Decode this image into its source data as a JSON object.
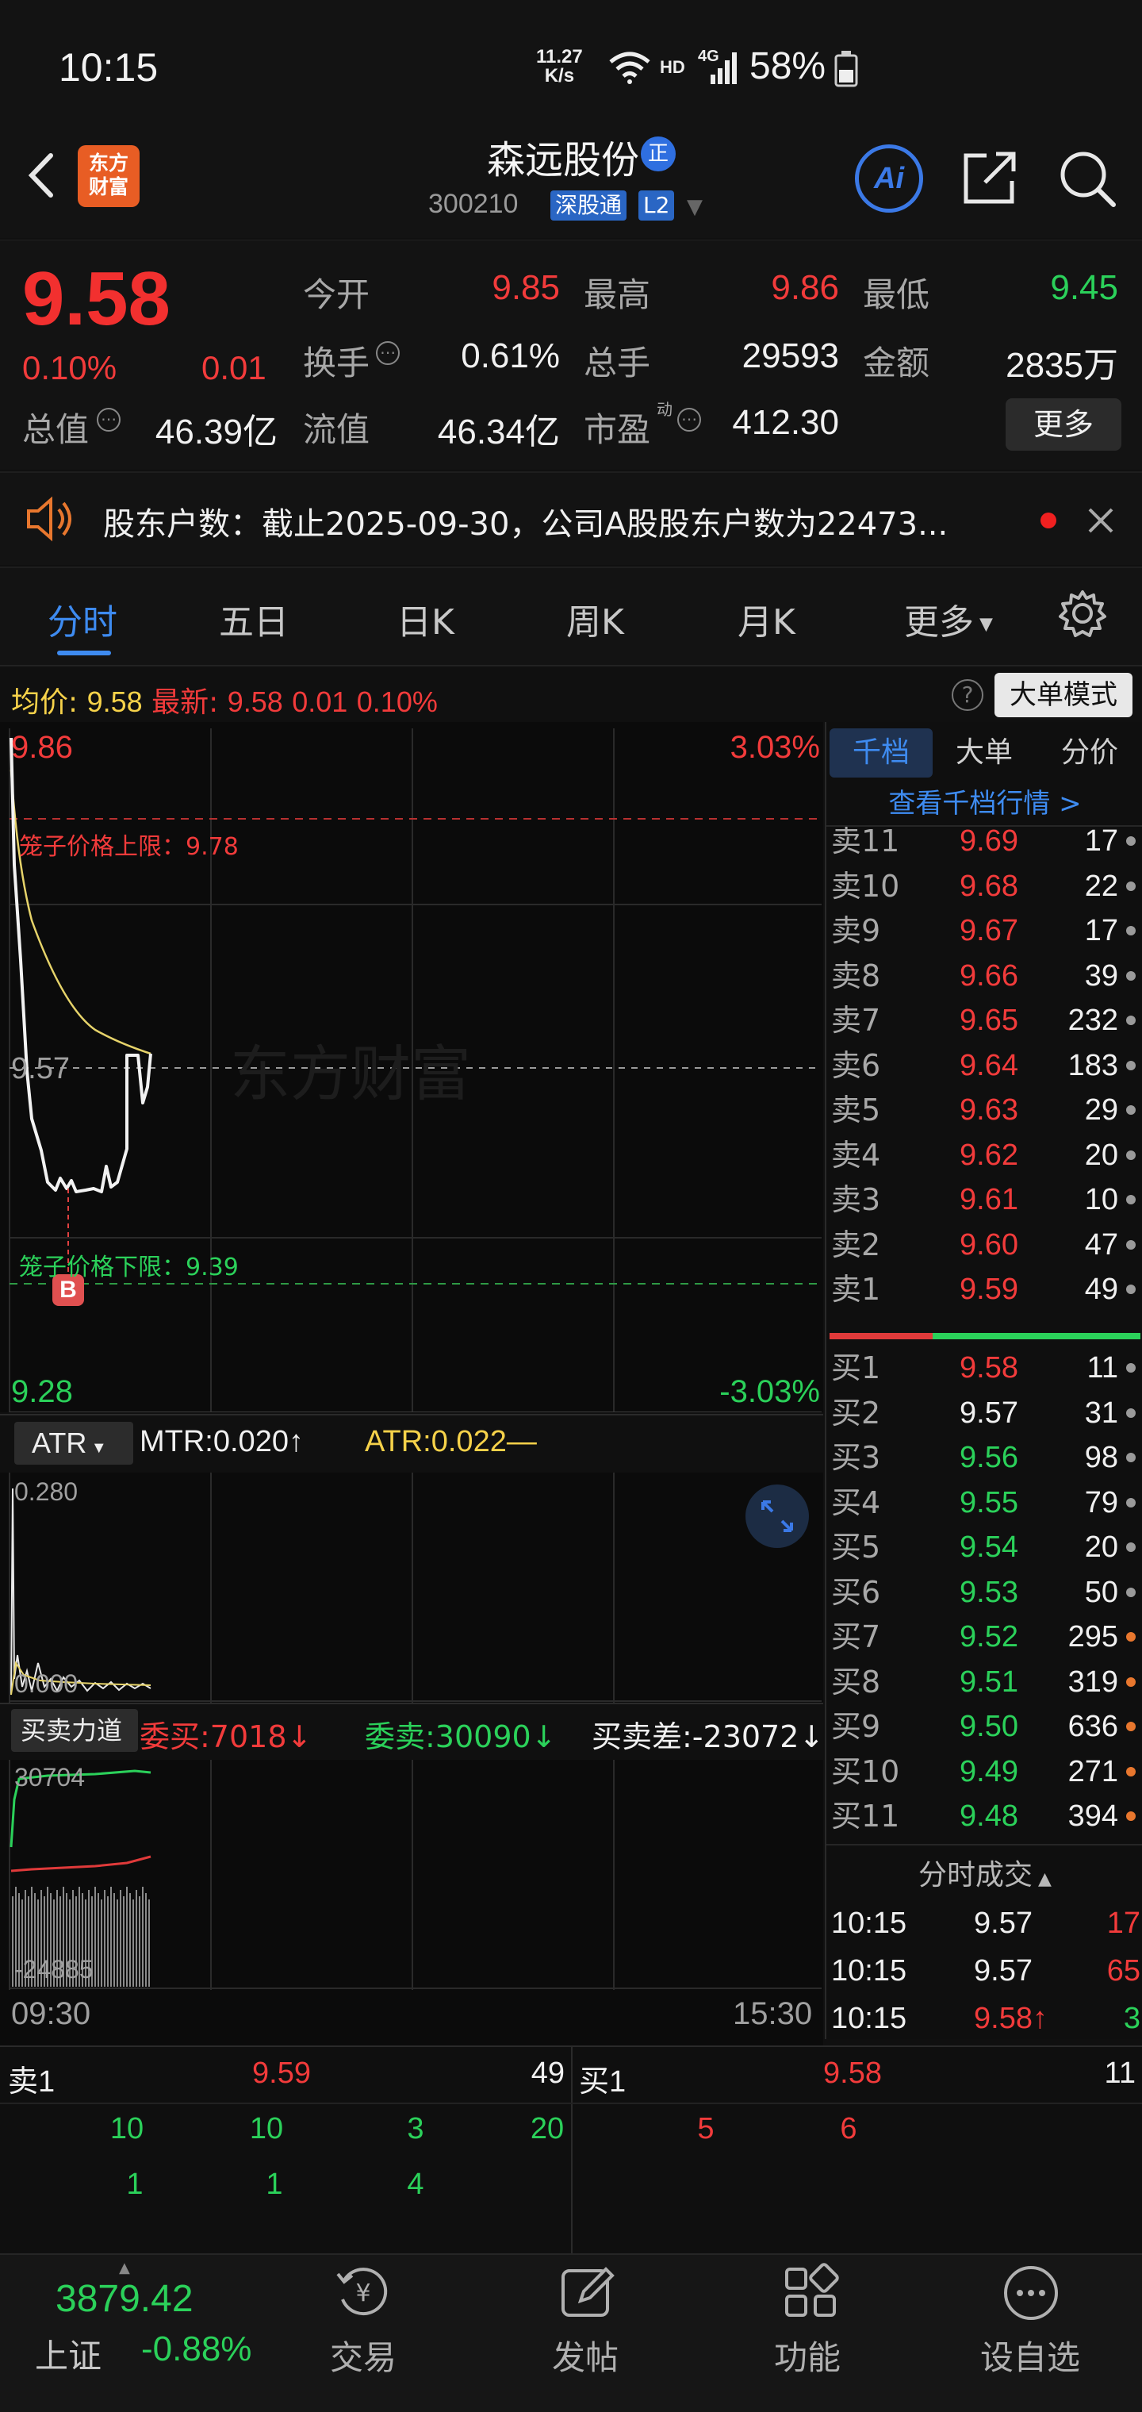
{
  "status": {
    "time": "10:15",
    "net_speed": "11.27",
    "net_unit": "K/s",
    "hd": "HD",
    "network": "4G",
    "battery": "58%"
  },
  "header": {
    "logo_text": "东方财富",
    "name": "森远股份",
    "name_badge": "正",
    "code": "300210",
    "market_badge": "深股通",
    "level_badge": "L2",
    "ai_label": "Ai"
  },
  "quote": {
    "price": "9.58",
    "change_pct": "0.10%",
    "change": "0.01",
    "open_label": "今开",
    "open": "9.85",
    "high_label": "最高",
    "high": "9.86",
    "low_label": "最低",
    "low": "9.45",
    "turnover_label": "换手",
    "turnover": "0.61%",
    "volume_label": "总手",
    "volume": "29593",
    "amount_label": "金额",
    "amount": "2835万",
    "mktcap_label": "总值",
    "mktcap": "46.39亿",
    "float_label": "流值",
    "float": "46.34亿",
    "pe_label": "市盈",
    "pe_sup": "动",
    "pe": "412.30",
    "more_label": "更多"
  },
  "notice": {
    "text": "股东户数：截止2025-09-30，公司A股股东户数为22473..."
  },
  "tabs": [
    "分时",
    "五日",
    "日K",
    "周K",
    "月K",
    "更多"
  ],
  "avgbar": {
    "avg_label": "均价:",
    "avg": "9.58",
    "latest_label": "最新:",
    "latest": "9.58",
    "chg": "0.01",
    "pct": "0.10%",
    "mode_label": "大单模式"
  },
  "chart": {
    "top_price": "9.86",
    "top_pct": "3.03%",
    "upper_limit": "笼子价格上限：9.78",
    "prev_close": "9.57",
    "lower_limit": "笼子价格下限：9.39",
    "bottom_price": "9.28",
    "bottom_pct": "-3.03%",
    "watermark": "东方财富",
    "b_marker": "B",
    "time_start": "09:30",
    "time_end": "15:30"
  },
  "atr": {
    "selector": "ATR",
    "mtr": "MTR:0.020",
    "mtr_arrow": "↑",
    "atr": "ATR:0.022",
    "atr_arrow": "—",
    "top": "0.280",
    "bottom": "0.000"
  },
  "force": {
    "selector": "买卖力道",
    "buy": "委买:7018",
    "buy_arrow": "↓",
    "sell": "委卖:30090",
    "sell_arrow": "↓",
    "diff": "买卖差:-23072",
    "diff_arrow": "↓",
    "top": "30704",
    "bottom": "-24885"
  },
  "orderbook": {
    "tabs": [
      "千档",
      "大单",
      "分价"
    ],
    "link": "查看千档行情 >",
    "asks": [
      {
        "label": "卖11",
        "price": "9.69",
        "vol": "17"
      },
      {
        "label": "卖10",
        "price": "9.68",
        "vol": "22"
      },
      {
        "label": "卖9",
        "price": "9.67",
        "vol": "17"
      },
      {
        "label": "卖8",
        "price": "9.66",
        "vol": "39"
      },
      {
        "label": "卖7",
        "price": "9.65",
        "vol": "232"
      },
      {
        "label": "卖6",
        "price": "9.64",
        "vol": "183"
      },
      {
        "label": "卖5",
        "price": "9.63",
        "vol": "29"
      },
      {
        "label": "卖4",
        "price": "9.62",
        "vol": "20"
      },
      {
        "label": "卖3",
        "price": "9.61",
        "vol": "10"
      },
      {
        "label": "卖2",
        "price": "9.60",
        "vol": "47"
      },
      {
        "label": "卖1",
        "price": "9.59",
        "vol": "49"
      }
    ],
    "bids": [
      {
        "label": "买1",
        "price": "9.58",
        "vol": "11",
        "color": "red"
      },
      {
        "label": "买2",
        "price": "9.57",
        "vol": "31",
        "color": "white"
      },
      {
        "label": "买3",
        "price": "9.56",
        "vol": "98",
        "color": "green"
      },
      {
        "label": "买4",
        "price": "9.55",
        "vol": "79",
        "color": "green"
      },
      {
        "label": "买5",
        "price": "9.54",
        "vol": "20",
        "color": "green"
      },
      {
        "label": "买6",
        "price": "9.53",
        "vol": "50",
        "color": "green"
      },
      {
        "label": "买7",
        "price": "9.52",
        "vol": "295",
        "color": "green"
      },
      {
        "label": "买8",
        "price": "9.51",
        "vol": "319",
        "color": "green"
      },
      {
        "label": "买9",
        "price": "9.50",
        "vol": "636",
        "color": "green"
      },
      {
        "label": "买10",
        "price": "9.49",
        "vol": "271",
        "color": "green"
      },
      {
        "label": "买11",
        "price": "9.48",
        "vol": "394",
        "color": "green"
      }
    ],
    "trades_title": "分时成交",
    "trades": [
      {
        "time": "10:15",
        "price": "9.57",
        "vol": "17"
      },
      {
        "time": "10:15",
        "price": "9.57",
        "vol": "65"
      },
      {
        "time": "10:15",
        "price": "9.58↑",
        "vol": "3"
      }
    ]
  },
  "level1": {
    "sell_label": "卖1",
    "sell_price": "9.59",
    "sell_vol": "49",
    "buy_label": "买1",
    "buy_price": "9.58",
    "buy_vol": "11",
    "sell_queue_1": [
      "10",
      "10",
      "3",
      "20"
    ],
    "sell_queue_2": [
      "1",
      "1",
      "4"
    ],
    "buy_queue": [
      "5",
      "6"
    ]
  },
  "nav": {
    "index_value": "3879.42",
    "index_name": "上证",
    "index_pct": "-0.88%",
    "items": [
      "交易",
      "发帖",
      "功能",
      "设自选"
    ]
  }
}
